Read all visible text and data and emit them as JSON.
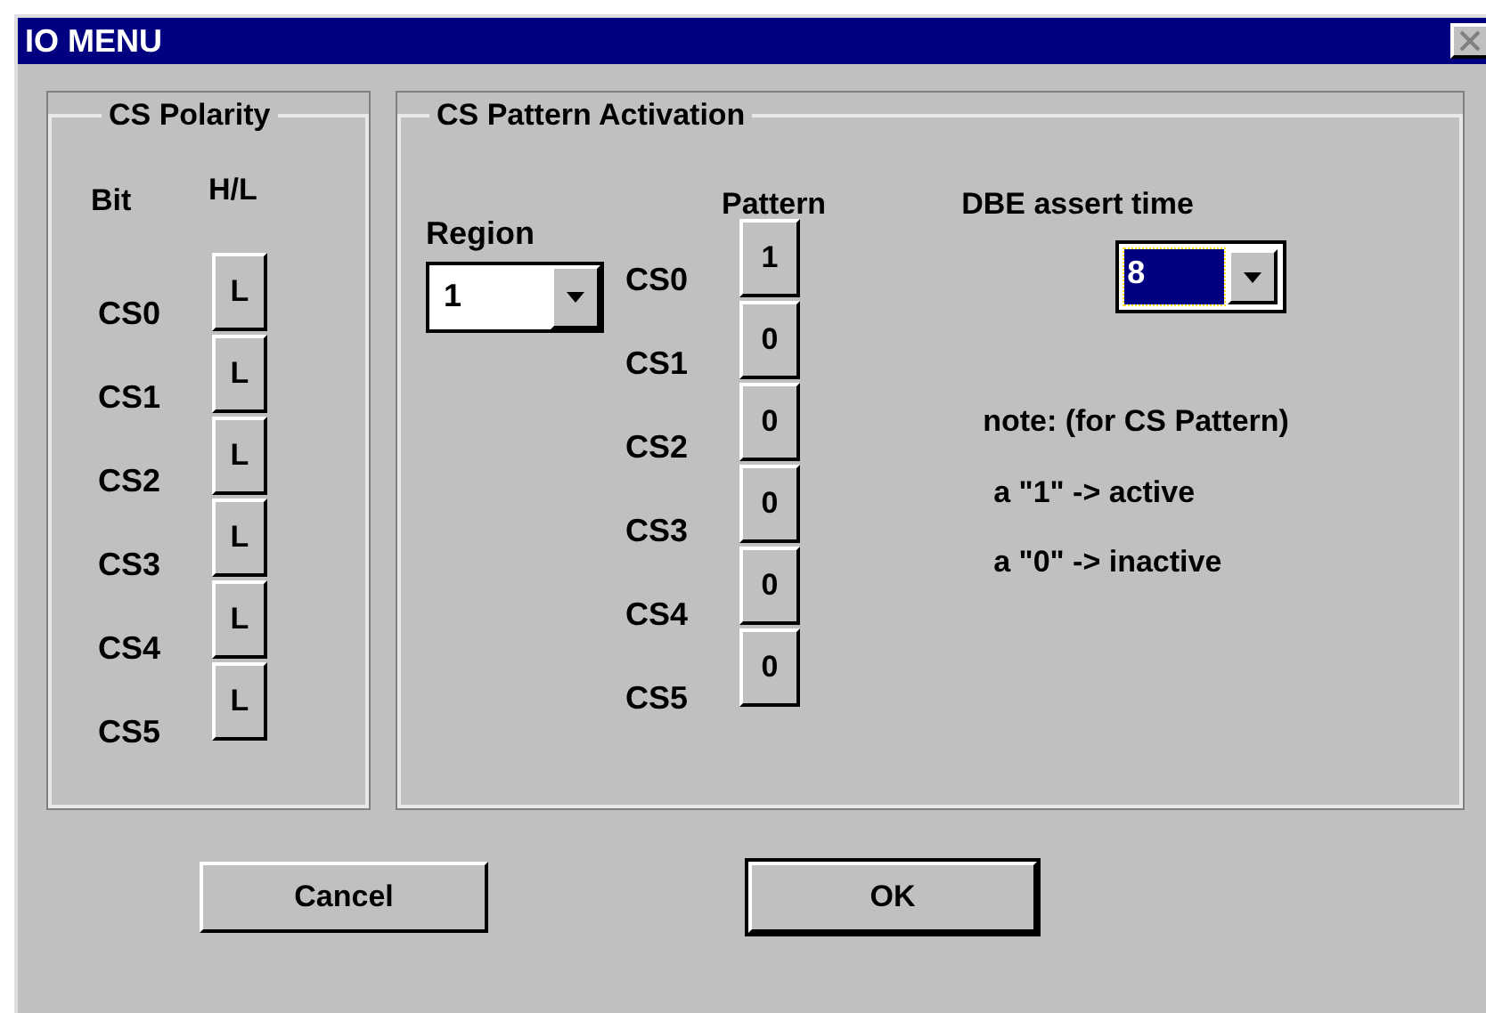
{
  "window": {
    "title": "IO MENU"
  },
  "polarity": {
    "title": "CS Polarity",
    "bit_header": "Bit",
    "hl_header": "H/L",
    "rows": [
      {
        "label": "CS0",
        "value": "L"
      },
      {
        "label": "CS1",
        "value": "L"
      },
      {
        "label": "CS2",
        "value": "L"
      },
      {
        "label": "CS3",
        "value": "L"
      },
      {
        "label": "CS4",
        "value": "L"
      },
      {
        "label": "CS5",
        "value": "L"
      }
    ]
  },
  "pattern": {
    "title": "CS Pattern Activation",
    "region_label": "Region",
    "region_value": "1",
    "pattern_header": "Pattern",
    "rows": [
      {
        "label": "CS0",
        "value": "1"
      },
      {
        "label": "CS1",
        "value": "0"
      },
      {
        "label": "CS2",
        "value": "0"
      },
      {
        "label": "CS3",
        "value": "0"
      },
      {
        "label": "CS4",
        "value": "0"
      },
      {
        "label": "CS5",
        "value": "0"
      }
    ],
    "dbe_label": "DBE assert time",
    "dbe_value": "8",
    "dbe_focused": true,
    "notes": [
      "note: (for CS Pattern)",
      "a \"1\" -> active",
      "a \"0\" -> inactive"
    ]
  },
  "buttons": [
    {
      "label": "Cancel",
      "default": false
    },
    {
      "label": "OK",
      "default": true
    }
  ]
}
